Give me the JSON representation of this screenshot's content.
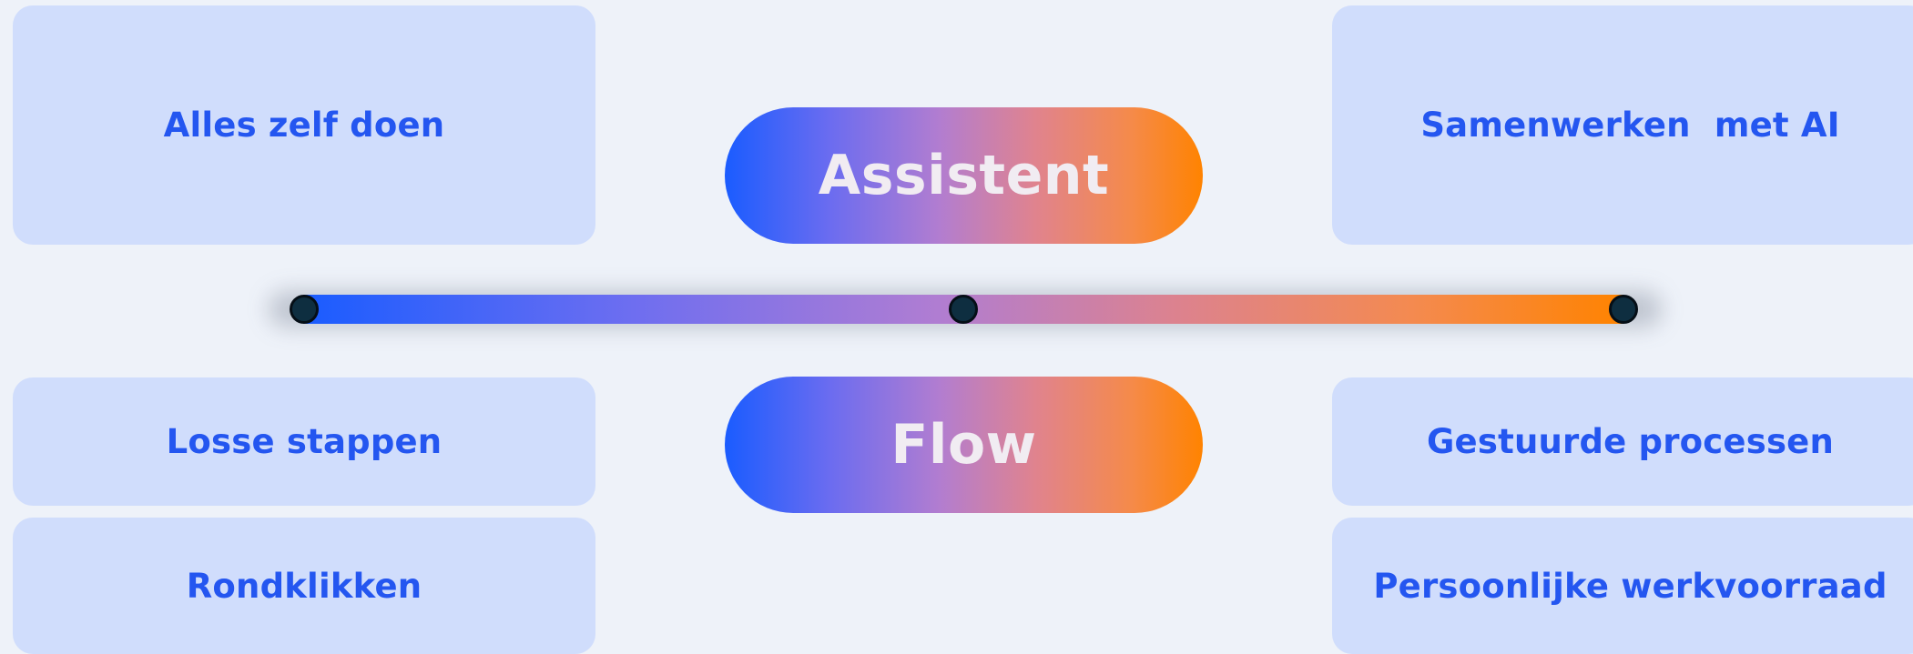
{
  "cards": {
    "left_top": "Alles zelf doen",
    "right_top": "Samenwerken  met AI",
    "left_mid": "Losse stappen",
    "right_mid": "Gestuurde processen",
    "left_bottom": "Rondklikken",
    "right_bottom": "Persoonlijke werkvoorraad"
  },
  "pills": {
    "top": "Assistent",
    "bottom": "Flow"
  },
  "colors": {
    "background": "#EEF2F9",
    "card": "#D0DDFC",
    "card_text": "#2456F0",
    "gradient_start": "#1A5CFF",
    "gradient_end": "#FF8300",
    "pill_text": "#F1ECF2",
    "dot": "#0E2E40"
  }
}
